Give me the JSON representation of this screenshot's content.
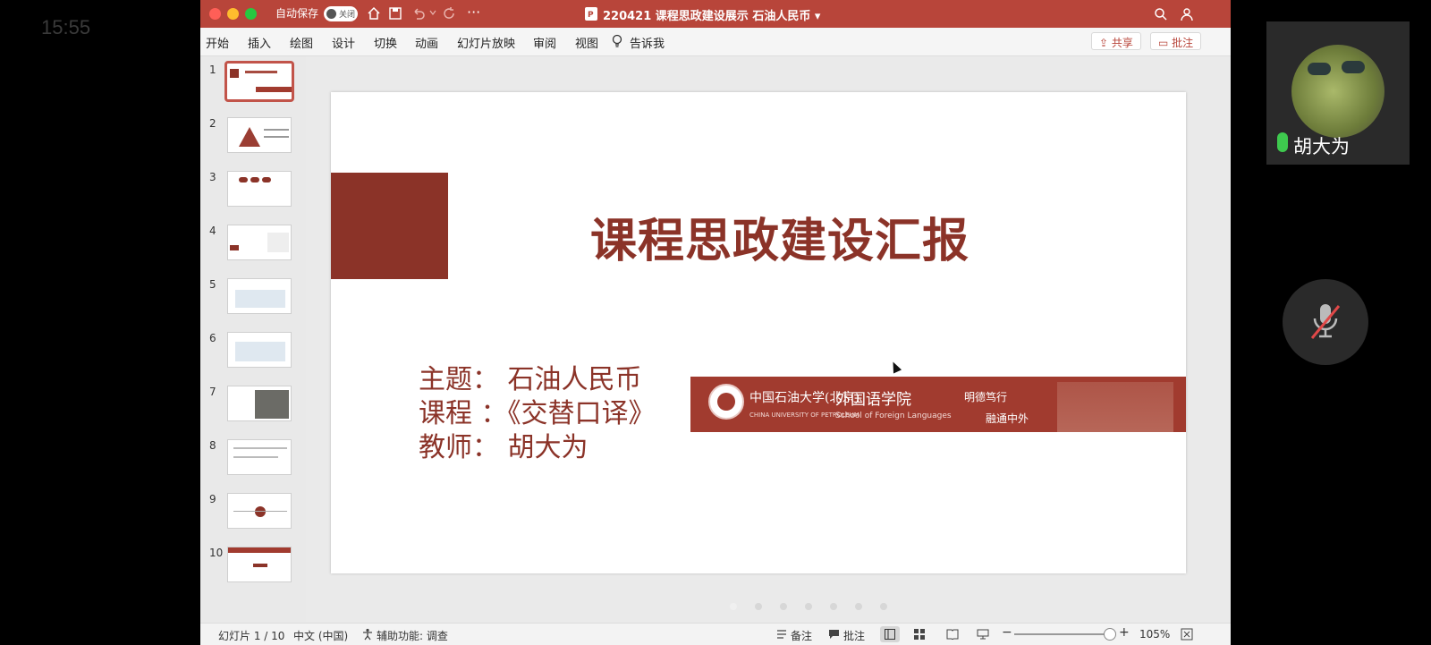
{
  "phone": {
    "time": "15:55"
  },
  "titlebar": {
    "autosave_label": "自动保存",
    "autosave_toggle": "关闭",
    "doc_title": "220421 课程思政建设展示 石油人民币 ▾"
  },
  "ribbon": {
    "tabs": [
      "开始",
      "插入",
      "绘图",
      "设计",
      "切换",
      "动画",
      "幻灯片放映",
      "审阅",
      "视图"
    ],
    "tell_me": "告诉我",
    "share_label": "共享",
    "comments_label": "批注"
  },
  "slides_panel": {
    "numbers": [
      "1",
      "2",
      "3",
      "4",
      "5",
      "6",
      "7",
      "8",
      "9",
      "10"
    ],
    "selected": 1
  },
  "slide": {
    "title": "课程思政建设汇报",
    "topic_line": "主题：  石油人民币",
    "course_line": "课程 ：《交替口译》",
    "teacher_line": "教师：    胡大为",
    "banner": {
      "school_cn": "中国石油大学(北京)",
      "school_en": "CHINA UNIVERSITY OF PETROLEUM",
      "college_cn": "外国语学院",
      "college_en": "School of Foreign Languages",
      "motto_1": "明德笃行",
      "motto_2": "融通中外"
    }
  },
  "statusbar": {
    "slide_counter": "幻灯片 1 / 10",
    "language": "中文 (中国)",
    "accessibility": "辅助功能: 调查",
    "notes_label": "备注",
    "comments_label": "批注",
    "zoom": "105%"
  },
  "video": {
    "participant_name": "胡大为"
  },
  "colors": {
    "accent": "#b8453a",
    "slide_red": "#8b3328",
    "banner_red": "#a13b2f"
  }
}
